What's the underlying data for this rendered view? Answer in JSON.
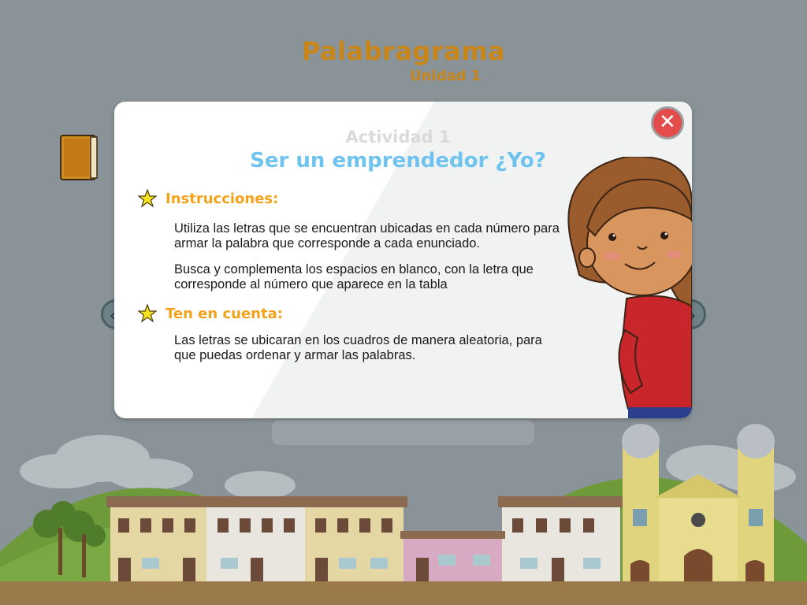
{
  "app": {
    "title": "Palabragrama",
    "subtitle": "Unidad 1"
  },
  "modal": {
    "activity_label": "Actividad 1",
    "activity_title": "Ser un emprendedor ¿Yo?",
    "close_label": "✕",
    "sections": [
      {
        "heading": "Instrucciones:",
        "paragraphs": [
          "Utiliza las letras que se encuentran ubicadas en cada número para armar la palabra que corresponde a cada enunciado.",
          "Busca y complementa los espacios en blanco, con la letra que corresponde al número que aparece en  la tabla"
        ]
      },
      {
        "heading": "Ten en cuenta:",
        "paragraphs": [
          "Las letras se ubicaran en los cuadros de manera aleatoria, para que puedas ordenar y armar las palabras."
        ]
      }
    ]
  },
  "nav": {
    "prev_icon": "‹",
    "next_icon": "›"
  },
  "colors": {
    "background": "#8a9398",
    "title": "#c8861a",
    "activity_title": "#6fc3ef",
    "heading": "#f3a21c",
    "close": "#e44c4c"
  },
  "icons": [
    "book-icon",
    "star-icon",
    "close-icon",
    "arrow-left-icon",
    "arrow-right-icon"
  ]
}
